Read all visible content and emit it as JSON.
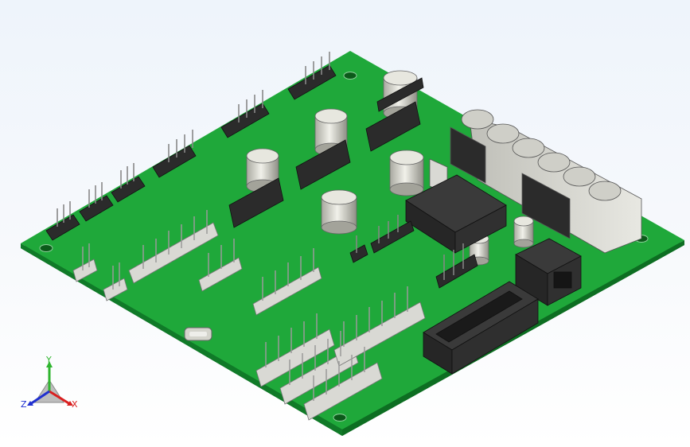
{
  "viewport": {
    "background": "#f2f6fb"
  },
  "model": {
    "board_color": "#1fa83a",
    "board_edge_color": "#0c6a20",
    "component_dark": "#2b2b2b",
    "component_light": "#d9d9d4",
    "capacitor_color": "#cfcfc6"
  },
  "triad": {
    "x_label": "X",
    "y_label": "Y",
    "z_label": "Z",
    "x_color": "#d92020",
    "y_color": "#2fb52f",
    "z_color": "#2030d0"
  }
}
